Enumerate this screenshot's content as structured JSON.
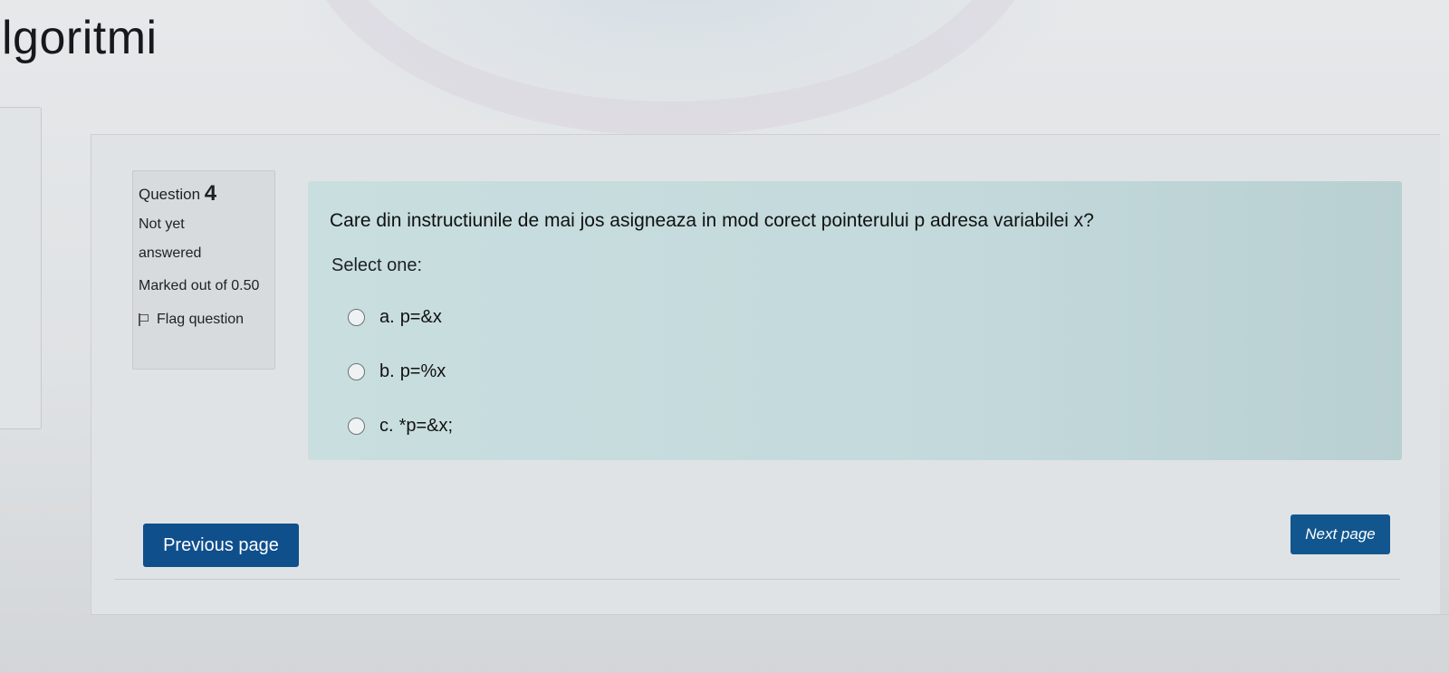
{
  "page": {
    "title": "lgoritmi"
  },
  "question_info": {
    "label": "Question",
    "number": "4",
    "state": "Not yet answered",
    "marks": "Marked out of 0.50",
    "flag_label": "Flag question"
  },
  "question": {
    "text": "Care din instructiunile de mai jos asigneaza in mod corect pointerului p adresa variabilei x?",
    "prompt": "Select one:",
    "answers": [
      {
        "letter": "a.",
        "text": "p=&x"
      },
      {
        "letter": "b.",
        "text": "p=%x"
      },
      {
        "letter": "c.",
        "text": "*p=&x;"
      }
    ]
  },
  "navigation": {
    "previous_label": "Previous page",
    "next_label": "Next page"
  }
}
